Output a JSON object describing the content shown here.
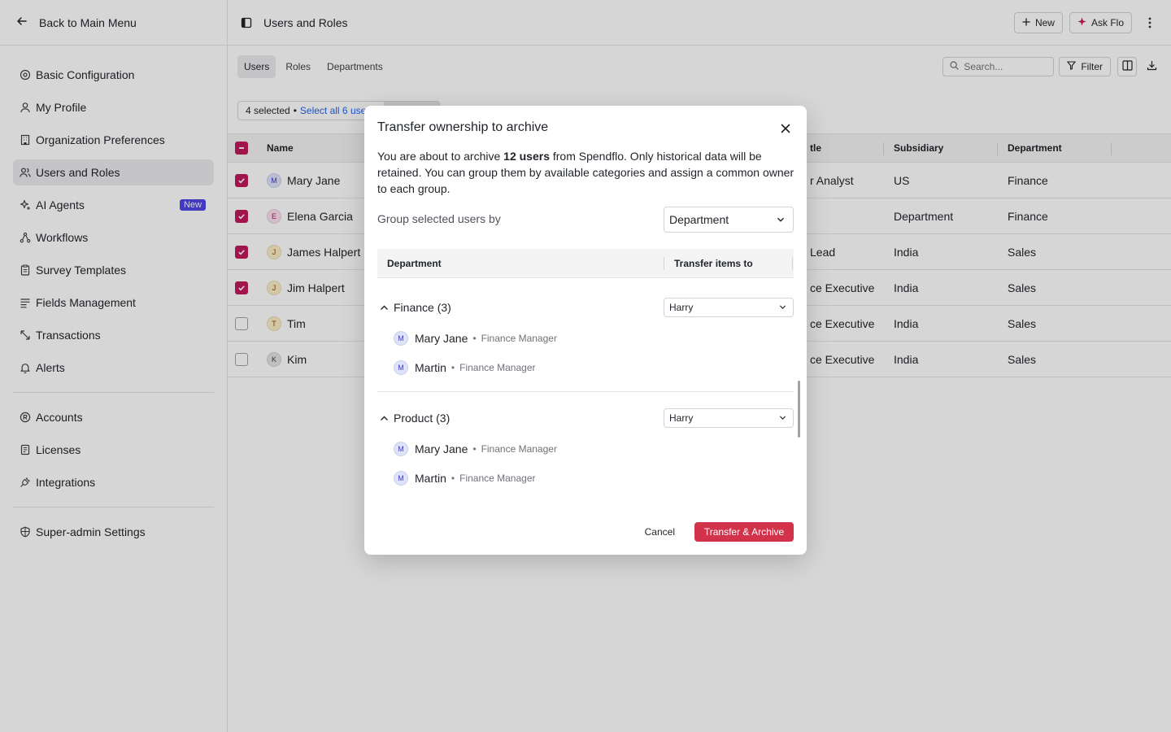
{
  "sidebar": {
    "back_label": "Back to Main Menu",
    "items": [
      {
        "label": "Basic Configuration"
      },
      {
        "label": "My Profile"
      },
      {
        "label": "Organization Preferences"
      },
      {
        "label": "Users and Roles"
      },
      {
        "label": "AI Agents",
        "badge": "New"
      },
      {
        "label": "Workflows"
      },
      {
        "label": "Survey Templates"
      },
      {
        "label": "Fields Management"
      },
      {
        "label": "Transactions"
      },
      {
        "label": "Alerts"
      },
      {
        "label": "Accounts"
      },
      {
        "label": "Licenses"
      },
      {
        "label": "Integrations"
      },
      {
        "label": "Super-admin Settings"
      }
    ]
  },
  "header": {
    "title": "Users and Roles",
    "new_label": "New",
    "ask_label": "Ask Flo"
  },
  "tabs": [
    {
      "label": "Users"
    },
    {
      "label": "Roles"
    },
    {
      "label": "Departments"
    }
  ],
  "toolbar": {
    "search_placeholder": "Search...",
    "filter_label": "Filter"
  },
  "selection": {
    "count_label": "4 selected",
    "separator": "•",
    "select_all_label": "Select all 6 use"
  },
  "table": {
    "columns": [
      "Name",
      "tle",
      "Subsidiary",
      "Department"
    ],
    "rows": [
      {
        "initial": "M",
        "name": "Mary Jane",
        "title": "r Analyst",
        "subsidiary": "US",
        "department": "Finance",
        "checked": true
      },
      {
        "initial": "E",
        "name": "Elena Garcia",
        "title": "",
        "subsidiary": "Department",
        "department": "Finance",
        "checked": true
      },
      {
        "initial": "J",
        "name": "James Halpert",
        "title": "Lead",
        "subsidiary": "India",
        "department": "Sales",
        "checked": true
      },
      {
        "initial": "J",
        "name": "Jim Halpert",
        "title": "ce Executive",
        "subsidiary": "India",
        "department": "Sales",
        "checked": true
      },
      {
        "initial": "T",
        "name": "Tim",
        "title": "ce Executive",
        "subsidiary": "India",
        "department": "Sales",
        "checked": false
      },
      {
        "initial": "K",
        "name": "Kim",
        "title": "ce Executive",
        "subsidiary": "India",
        "department": "Sales",
        "checked": false
      }
    ]
  },
  "modal": {
    "title": "Transfer ownership to archive",
    "desc_prefix": "You are about to archive ",
    "desc_count": "12 users",
    "desc_suffix": " from Spendflo. Only historical data will be retained. You can group them by available categories and assign a common owner to each group.",
    "group_by_label": "Group selected users by",
    "group_by_value": "Department",
    "col_department": "Department",
    "col_transfer": "Transfer items to",
    "groups": [
      {
        "name": "Finance (3)",
        "owner": "Harry",
        "members": [
          {
            "initial": "M",
            "name": "Mary Jane",
            "sep": "•",
            "role": "Finance Manager"
          },
          {
            "initial": "M",
            "name": "Martin",
            "sep": "•",
            "role": "Finance Manager"
          }
        ]
      },
      {
        "name": "Product (3)",
        "owner": "Harry",
        "members": [
          {
            "initial": "M",
            "name": "Mary Jane",
            "sep": "•",
            "role": "Finance Manager"
          },
          {
            "initial": "M",
            "name": "Martin",
            "sep": "•",
            "role": "Finance Manager"
          }
        ]
      }
    ],
    "cancel_label": "Cancel",
    "primary_label": "Transfer & Archive"
  },
  "colors": {
    "primary": "#d2334b",
    "checkbox": "#c2185b",
    "badge": "#4f46e5",
    "link": "#2563eb"
  }
}
